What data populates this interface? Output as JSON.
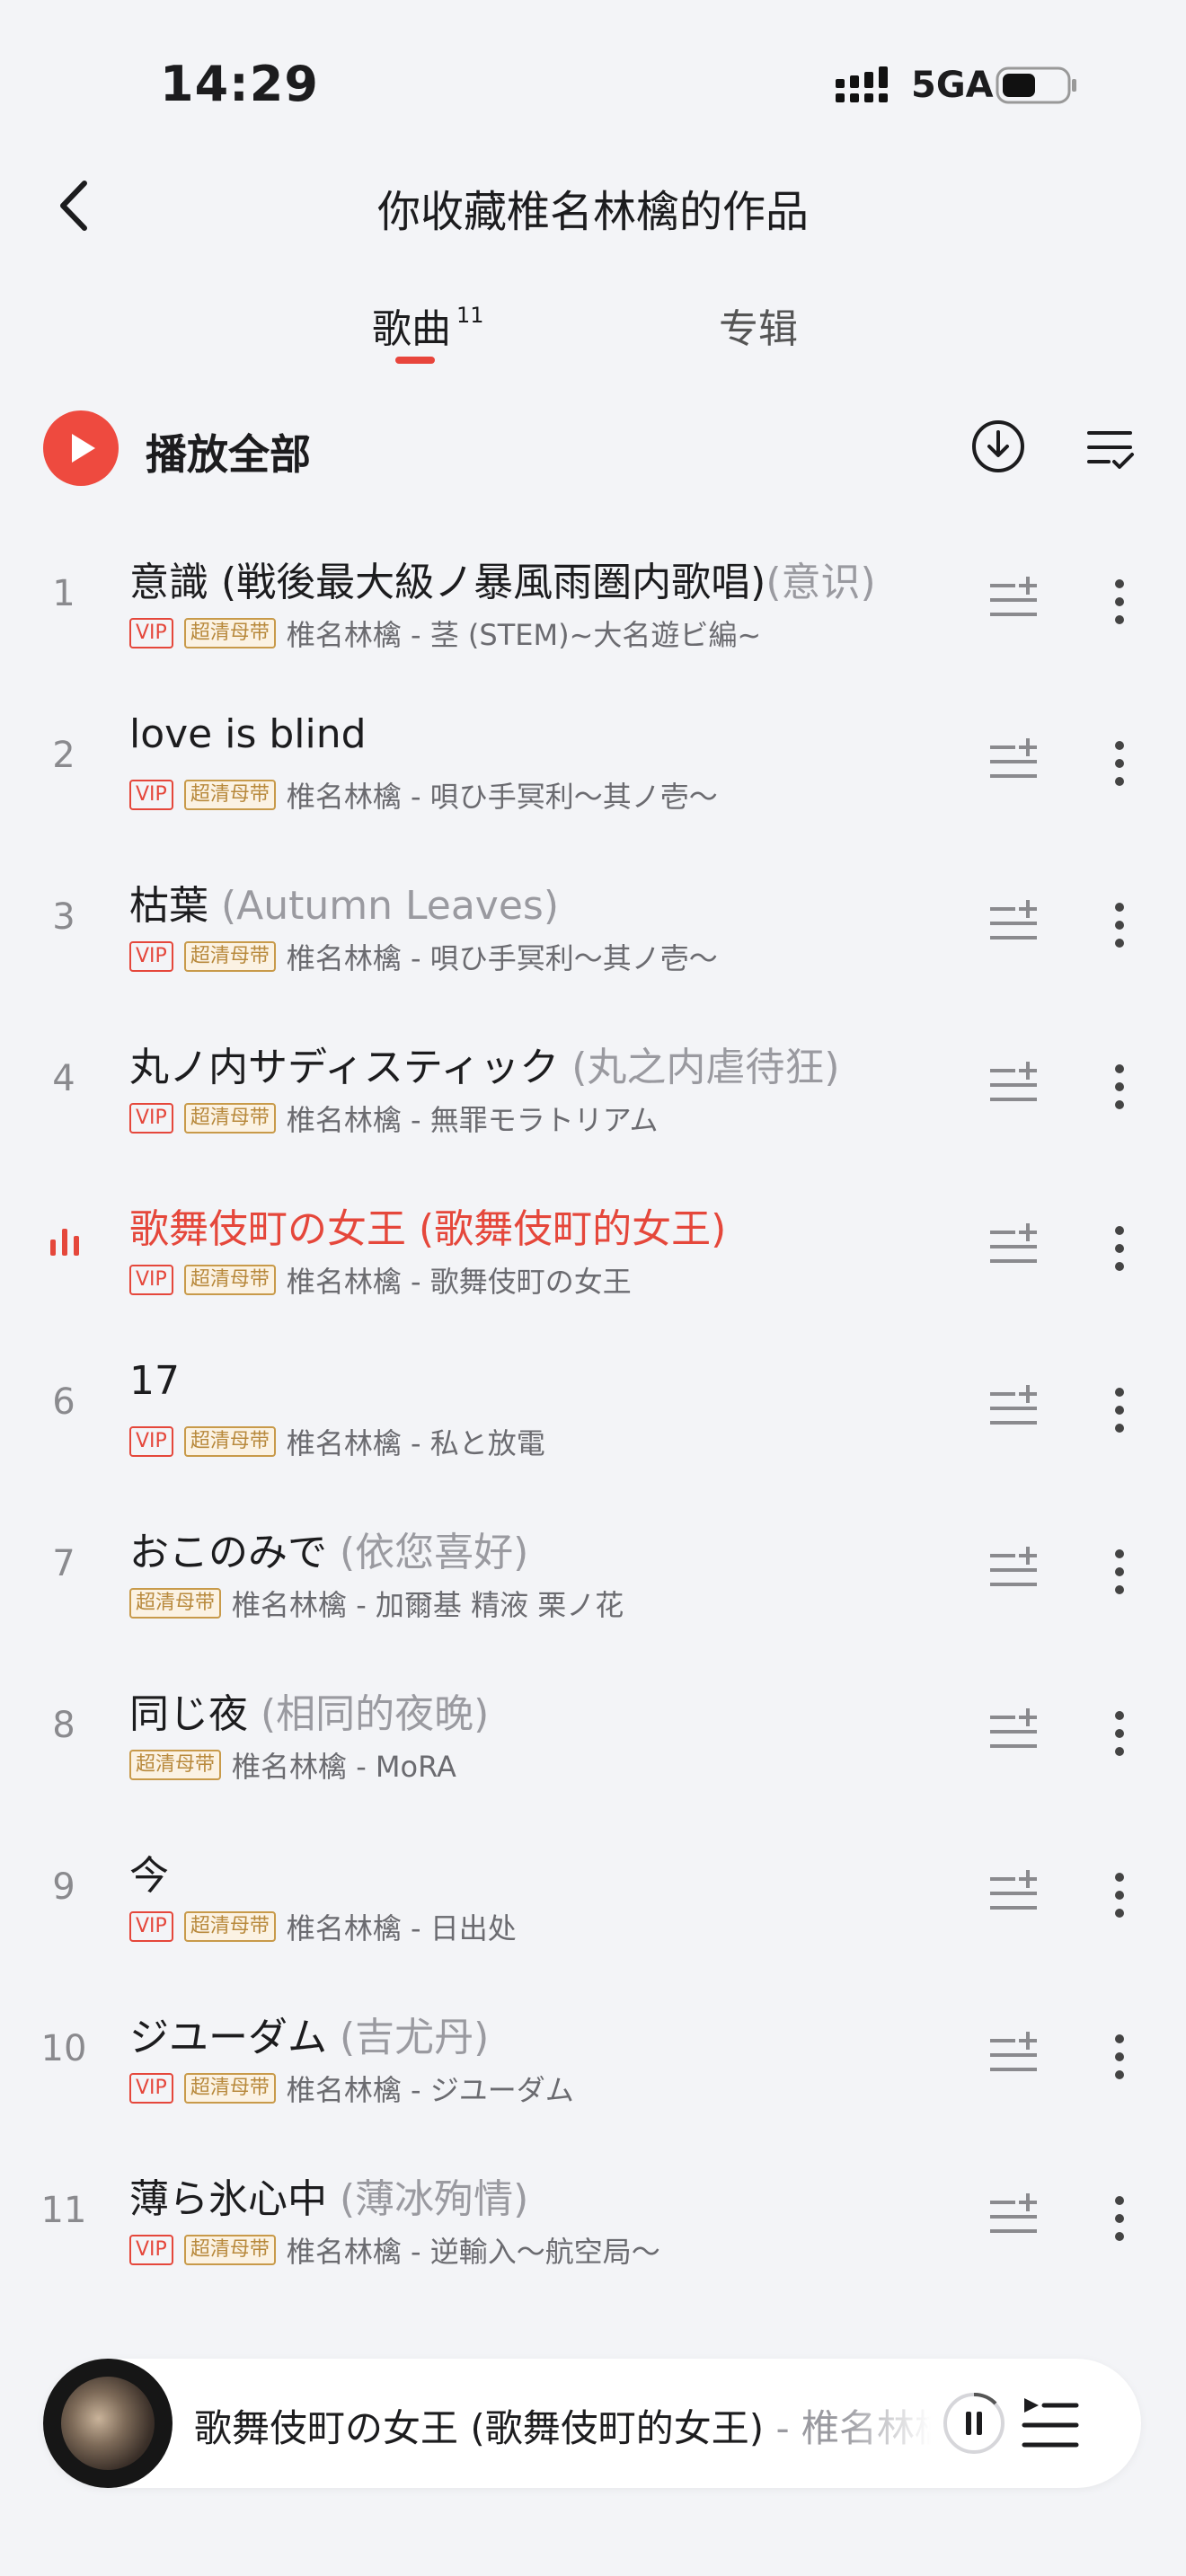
{
  "status": {
    "time": "14:29",
    "network": "5GA"
  },
  "header": {
    "title": "你收藏椎名林檎的作品"
  },
  "tabs": [
    {
      "label": "歌曲",
      "count": "11"
    },
    {
      "label": "专辑"
    }
  ],
  "play_all": {
    "label": "播放全部"
  },
  "songs": [
    {
      "index": "1",
      "title": "意識 (戦後最大級ノ暴風雨圏内歌唱)",
      "subtitle": "(意识)",
      "vip": "VIP",
      "hq": "超清母带",
      "info": "椎名林檎 - 茎 (STEM)~大名遊ビ編~"
    },
    {
      "index": "2",
      "title": "love is blind",
      "subtitle": "",
      "vip": "VIP",
      "hq": "超清母带",
      "info": "椎名林檎 - 唄ひ手冥利～其ノ壱～"
    },
    {
      "index": "3",
      "title": "枯葉 ",
      "subtitle": "(Autumn Leaves)",
      "vip": "VIP",
      "hq": "超清母带",
      "info": "椎名林檎 - 唄ひ手冥利～其ノ壱～"
    },
    {
      "index": "4",
      "title": "丸ノ内サディスティック ",
      "subtitle": "(丸之内虐待狂)",
      "vip": "VIP",
      "hq": "超清母带",
      "info": "椎名林檎 - 無罪モラトリアム"
    },
    {
      "index": "",
      "title": "歌舞伎町の女王 ",
      "subtitle": "(歌舞伎町的女王)",
      "vip": "VIP",
      "hq": "超清母带",
      "info": "椎名林檎 - 歌舞伎町の女王"
    },
    {
      "index": "6",
      "title": "17",
      "subtitle": "",
      "vip": "VIP",
      "hq": "超清母带",
      "info": "椎名林檎 - 私と放電"
    },
    {
      "index": "7",
      "title": "おこのみで ",
      "subtitle": "(依您喜好)",
      "vip": "",
      "hq": "超清母带",
      "info": "椎名林檎 - 加爾基 精液 栗ノ花"
    },
    {
      "index": "8",
      "title": "同じ夜 ",
      "subtitle": "(相同的夜晚)",
      "vip": "",
      "hq": "超清母带",
      "info": "椎名林檎 - MoRA"
    },
    {
      "index": "9",
      "title": "今",
      "subtitle": "",
      "vip": "VIP",
      "hq": "超清母带",
      "info": "椎名林檎 - 日出处"
    },
    {
      "index": "10",
      "title": "ジユーダム ",
      "subtitle": "(吉尤丹)",
      "vip": "VIP",
      "hq": "超清母带",
      "info": "椎名林檎 - ジユーダム"
    },
    {
      "index": "11",
      "title": "薄ら氷心中 ",
      "subtitle": "(薄冰殉情)",
      "vip": "VIP",
      "hq": "超清母带",
      "info": "椎名林檎 - 逆輸入～航空局～"
    }
  ],
  "player": {
    "track": "歌舞伎町の女王 (歌舞伎町的女王)",
    "artist": " - 椎名林檎"
  },
  "colors": {
    "accent": "#e5473b",
    "background": "#f3f4f7"
  },
  "icons": [
    "back-icon",
    "play-icon",
    "download-icon",
    "manage-list-icon",
    "add-to-playlist-icon",
    "more-icon",
    "playing-bars-icon",
    "pause-icon",
    "playlist-icon"
  ]
}
